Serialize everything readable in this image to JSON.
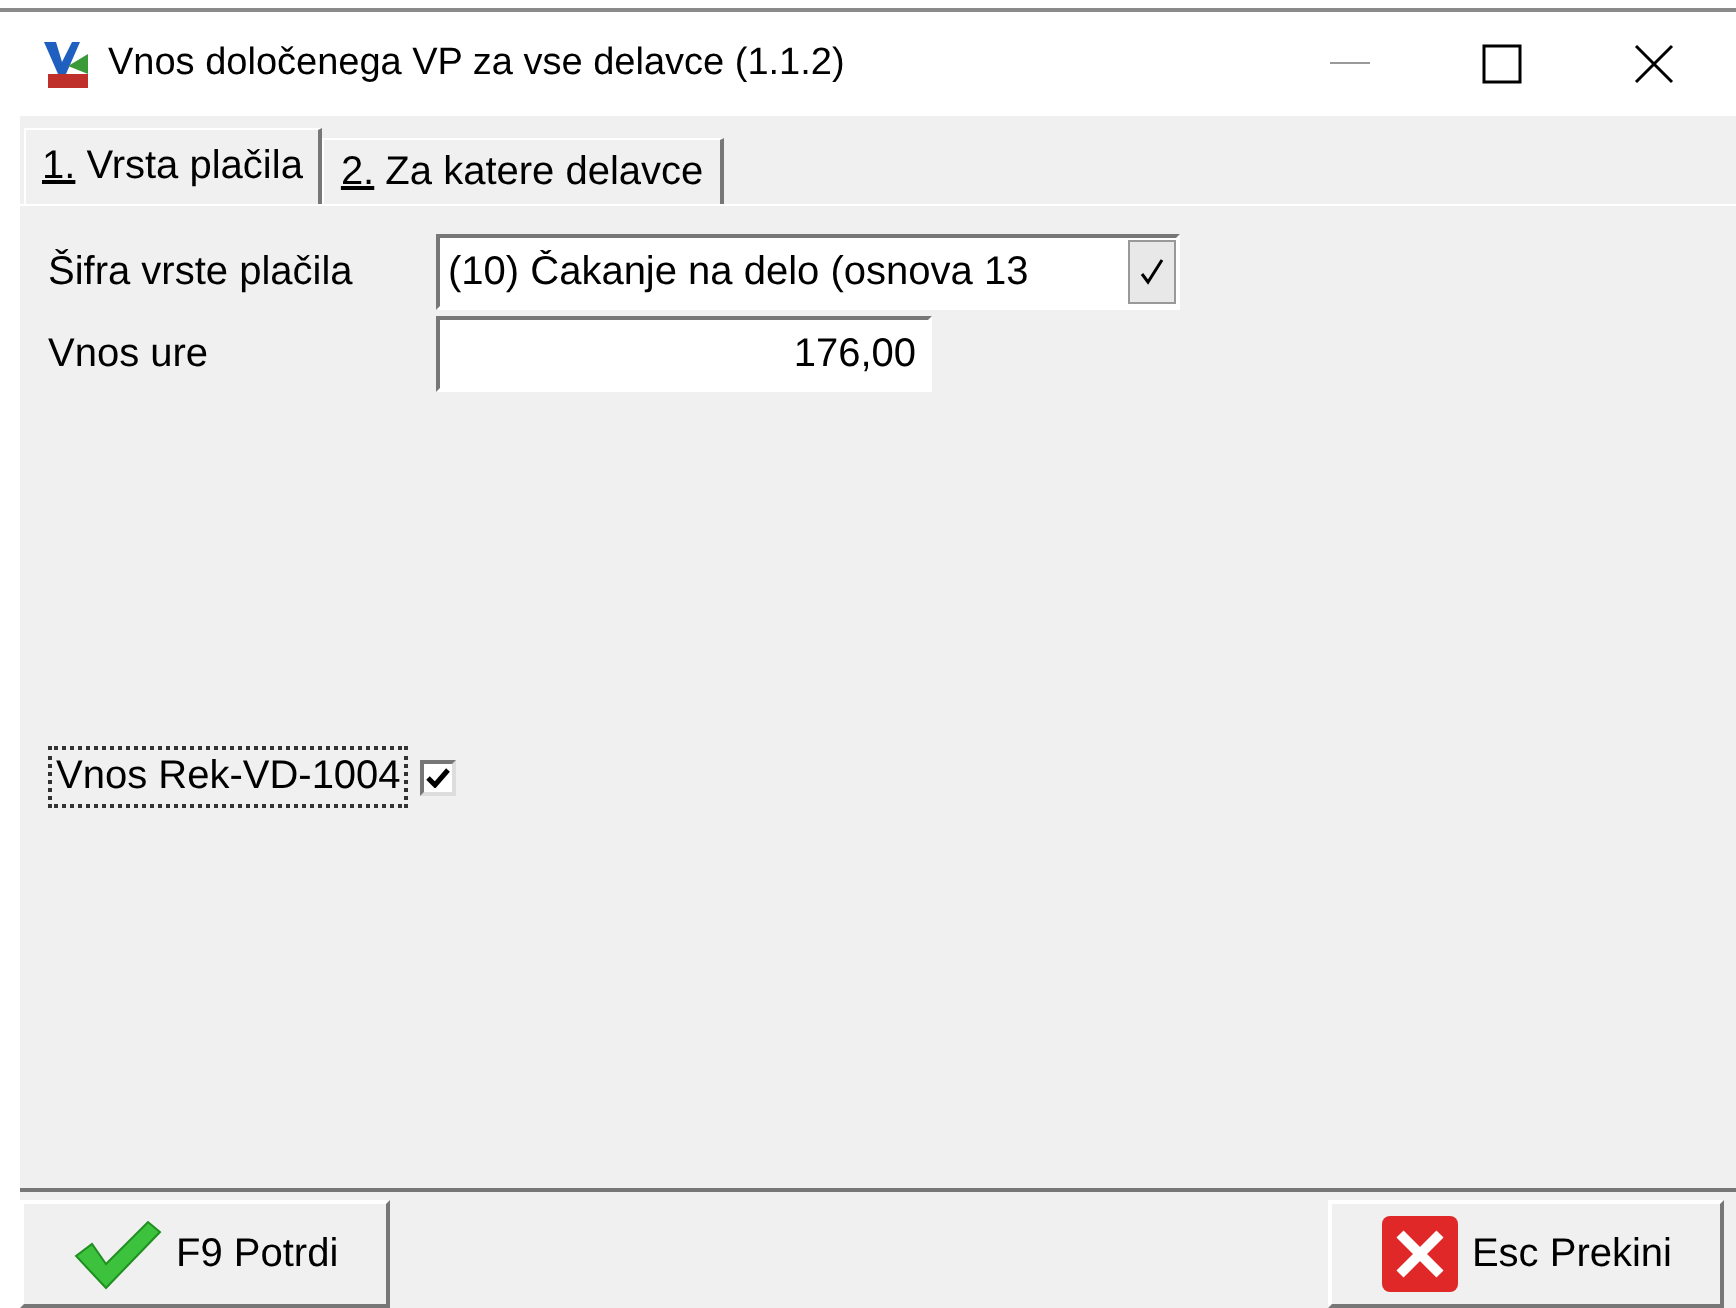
{
  "window": {
    "title": "Vnos določenega VP za vse delavce  (1.1.2)"
  },
  "tabs": [
    {
      "label": "1. Vrsta plačila",
      "selected": true
    },
    {
      "label": "2. Za katere delavce",
      "selected": false
    }
  ],
  "fields": [
    {
      "kind": "combo",
      "label": "Šifra vrste plačila",
      "value": "(10) Čakanje na delo (osnova 13"
    },
    {
      "kind": "number",
      "label": "Vnos ure",
      "value": "176,00"
    }
  ],
  "checkbox": {
    "label": "Vnos Rek-VD-1004",
    "checked": true,
    "focused": true
  },
  "buttons": [
    {
      "kind": "confirm",
      "label": "F9 Potrdi"
    },
    {
      "kind": "cancel",
      "label": "Esc Prekini"
    }
  ]
}
